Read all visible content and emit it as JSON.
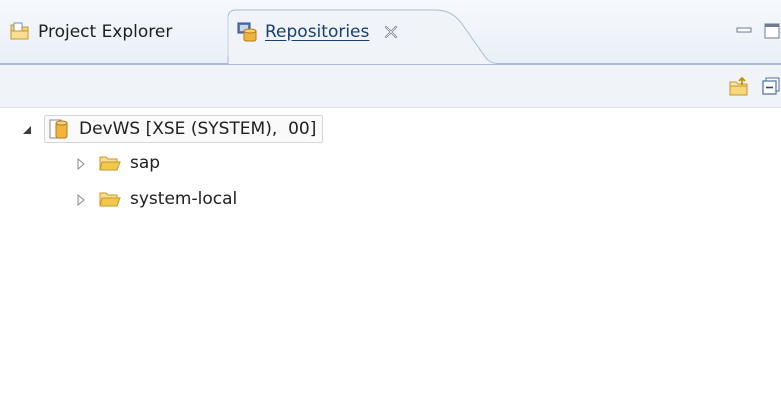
{
  "tabs": [
    {
      "label": "Project Explorer",
      "icon": "project-explorer-icon",
      "active": false
    },
    {
      "label": "Repositories",
      "icon": "repositories-icon",
      "active": true,
      "close_icon": "close-icon"
    }
  ],
  "view_controls": {
    "minimize_icon": "minimize-icon",
    "maximize_icon": "maximize-icon"
  },
  "toolbar": {
    "buttons": [
      {
        "icon": "new-repository-icon"
      },
      {
        "icon": "collapse-all-icon"
      }
    ]
  },
  "tree": {
    "root": {
      "label": "DevWS [XSE (SYSTEM),  00]",
      "icon": "workspace-repository-icon",
      "expanded": true,
      "children": [
        {
          "label": "sap",
          "icon": "folder-open-icon",
          "expanded": false
        },
        {
          "label": "system-local",
          "icon": "folder-open-icon",
          "expanded": false
        }
      ]
    }
  },
  "colors": {
    "tab_strip": "#e9eff7",
    "tab_border": "#a9bcd6",
    "active_tab_label": "#1b3e74",
    "folder": "#f2c84b"
  }
}
